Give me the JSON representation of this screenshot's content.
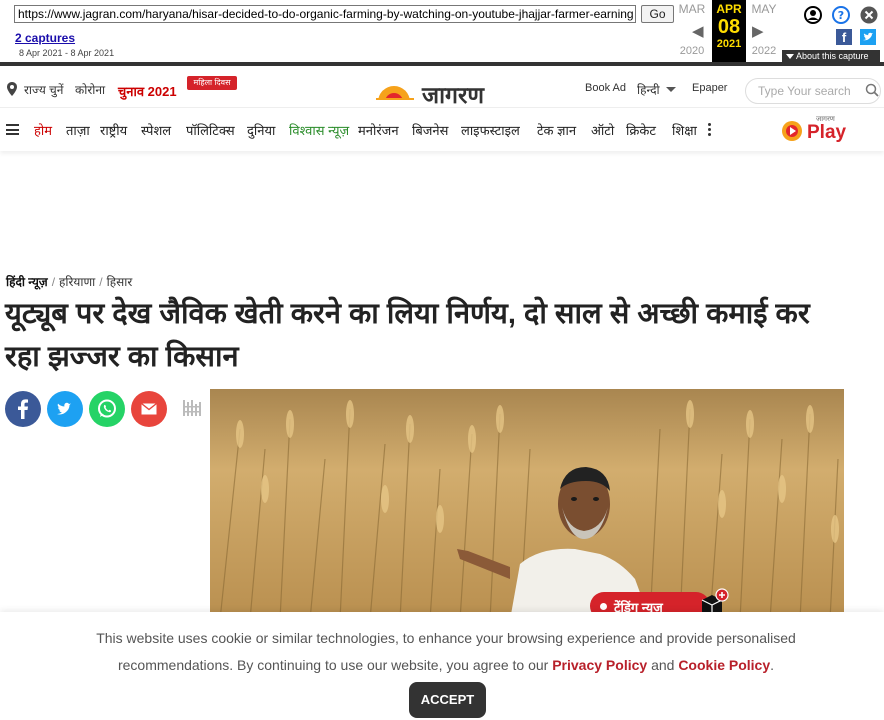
{
  "wayback": {
    "url": "https://www.jagran.com/haryana/hisar-decided-to-do-organic-farming-by-watching-on-youtube-jhajjar-farmer-earning",
    "go_label": "Go",
    "captures_label": "2 captures",
    "capture_range": "8 Apr 2021 - 8 Apr 2021",
    "prev_month": "MAR",
    "cur_month": "APR",
    "next_month": "MAY",
    "cur_day": "08",
    "prev_year": "2020",
    "cur_year": "2021",
    "next_year": "2022",
    "about_label": "About this capture"
  },
  "header": {
    "state_select": "राज्य चुनें",
    "corona": "कोरोना",
    "election": "चुनाव 2021",
    "women_badge": "महिला दिवस",
    "logo_text": "जागरण",
    "book_ad": "Book Ad",
    "language": "हिन्दी",
    "epaper": "Epaper",
    "search_placeholder": "Type Your search"
  },
  "nav": {
    "items": [
      "होम",
      "ताज़ा",
      "राष्ट्रीय",
      "स्पेशल",
      "पॉलिटिक्स",
      "दुनिया",
      "विश्वास न्यूज़",
      "मनोरंजन",
      "बिजनेस",
      "लाइफस्टाइल",
      "टेक ज्ञान",
      "ऑटो",
      "क्रिकेट",
      "शिक्षा"
    ],
    "play_label": "Play",
    "play_brand": "जागरण"
  },
  "article": {
    "breadcrumb": [
      "हिंदी न्यूज़",
      "हरियाणा",
      "हिसार"
    ],
    "headline": "यूट्यूब पर देख जैविक खेती करने का लिया निर्णय, दो साल से अच्छी कमाई कर रहा झज्जर का किसान"
  },
  "trending": {
    "label": "ट्रेंडिंग न्यूज़"
  },
  "cookie": {
    "text_1": "This website uses cookie or similar technologies, to enhance your browsing experience and provide personalised recommendations. By continuing to use our website, you agree to our",
    "privacy_link": "Privacy Policy",
    "and": "and",
    "cookie_link": "Cookie Policy",
    "period": ".",
    "accept_label": "ACCEPT"
  },
  "colors": {
    "brand_red": "#d5232a",
    "facebook": "#3b5998",
    "twitter": "#1da1f2",
    "whatsapp": "#25d366",
    "email": "#e8453c"
  }
}
